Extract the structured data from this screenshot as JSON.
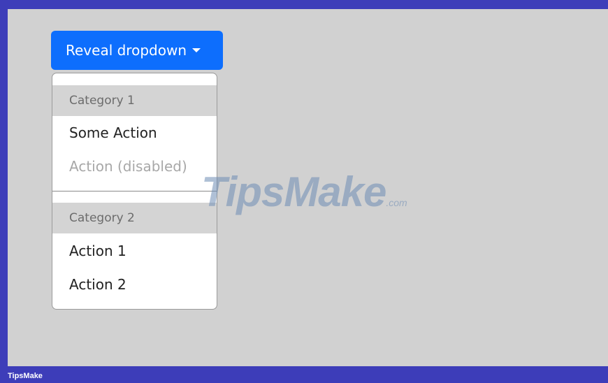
{
  "dropdown": {
    "toggle_label": "Reveal dropdown",
    "toggle_color": "#0d6efd",
    "caret_icon": "caret-down-icon",
    "groups": [
      {
        "header": "Category 1",
        "items": [
          {
            "label": "Some Action",
            "disabled": false
          },
          {
            "label": "Action (disabled)",
            "disabled": true
          }
        ]
      },
      {
        "header": "Category 2",
        "items": [
          {
            "label": "Action 1",
            "disabled": false
          },
          {
            "label": "Action 2",
            "disabled": false
          }
        ]
      }
    ]
  },
  "watermark": {
    "main": "TipsMake",
    "suffix": ".com"
  },
  "footer": {
    "label": "TipsMake"
  }
}
